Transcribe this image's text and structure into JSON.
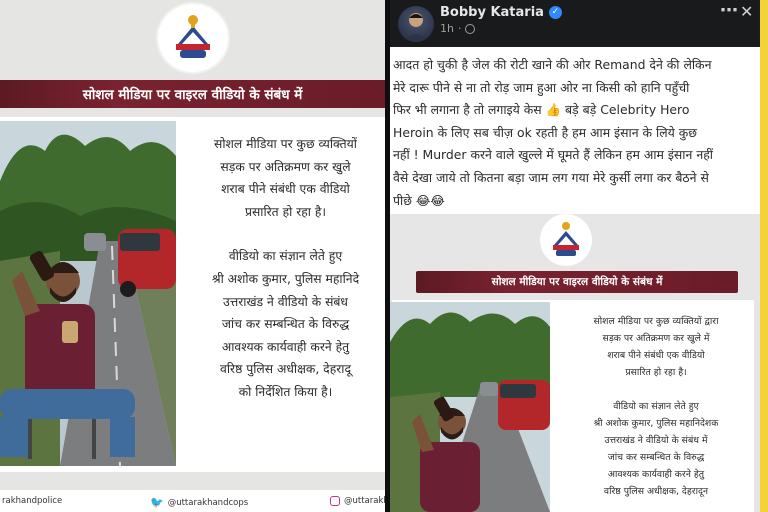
{
  "left_panel": {
    "banner": "सोशल मीडिया पर वाइरल वीडियो के संबंध में",
    "notice_lines": [
      "सोशल मीडिया पर कुछ व्यक्तियों",
      "सड़क पर अतिक्रमण कर खुले",
      "शराब पीने संबंधी एक वीडियो",
      "प्रसारित हो रहा है।",
      "",
      "वीडियो का संज्ञान लेते हुए",
      "श्री अशोक कुमार, पुलिस महानिदे",
      "उत्तराखंड ने वीडियो के संबंध",
      "जांच कर सम्बन्धित के विरुद्ध",
      "आवश्यक कार्यवाही करने हेतु",
      "वरिष्ठ पुलिस अधीक्षक, देहरादू",
      "को निर्देशित किया है।"
    ],
    "footer": {
      "facebook": "rakhandpolice",
      "twitter": "@uttarakhandcops",
      "instagram": "@uttarakh"
    }
  },
  "right_panel": {
    "author": "Bobby Kataria",
    "time": "1h",
    "more_icon": "⋯",
    "close_icon": "✕",
    "post_lines": [
      "आदत हो चुकी है जेल की रोटी खाने की ओर Remand देने की लेकिन",
      "मेरे दारू पीने से ना तो रोड़ जाम हुआ ओर ना किसी को हानि पहुँची",
      "फिर भी लगाना है तो लगाइये केस 👍 बड़े बड़े Celebrity Hero",
      "Heroin के लिए सब चीज़ ok रहती है हम आम इंसान के लिये कुछ",
      "नहीं ! Murder करने वाले खुल्ले में घूमते हैं लेकिन हम आम इंसान नहीं",
      "वैसे देखा जाये तो कितना बड़ा जाम लग गया मेरे कुर्सी लगा कर बैठने से",
      "पीछे 😂😂"
    ],
    "banner": "सोशल मीडिया पर वाइरल वीडियो के संबंध में",
    "notice_lines": [
      "सोशल मीडिया पर कुछ व्यक्तियों द्वारा",
      "सड़क पर अतिक्रमण कर खुले में",
      "शराब पीने संबंधी एक वीडियो",
      "प्रसारित हो रहा है।",
      "",
      "वीडियो का संज्ञान लेते हुए",
      "श्री अशोक कुमार, पुलिस महानिदेशक",
      "उत्तराखंड ने वीडियो के संबंध में",
      "जांच कर सम्बन्धित के विरुद्ध",
      "आवश्यक कार्यवाही करने हेतु",
      "वरिष्ठ पुलिस अधीक्षक, देहरादून"
    ]
  },
  "colors": {
    "banner": "#7a2230",
    "fb_dark": "#191a1c",
    "verified": "#2e89ff",
    "twitter": "#1d9bf0",
    "accent_yellow": "#f3d23a"
  },
  "icons": [
    "police-emblem-icon",
    "verified-icon",
    "globe-icon",
    "more-icon",
    "close-icon",
    "facebook-icon",
    "twitter-icon",
    "instagram-icon"
  ]
}
